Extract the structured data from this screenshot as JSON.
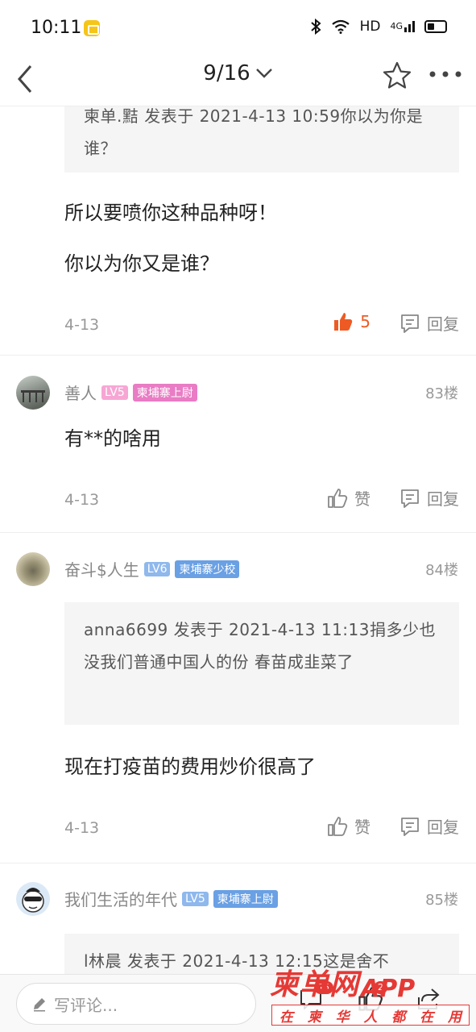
{
  "status_bar": {
    "time": "10:11",
    "network": "HD",
    "signal": "4G"
  },
  "nav": {
    "title": "9/16"
  },
  "thread": [
    {
      "quote": "柬单.黠 发表于 2021-4-13 10:59你以为你是谁？",
      "lines": [
        "所以要喷你这种品种呀！",
        "你以为你又是谁？"
      ],
      "date": "4-13",
      "like_label": "5",
      "liked": true,
      "reply_label": "回复"
    }
  ],
  "posts": [
    {
      "author": "善人",
      "level": "LV5",
      "level_color": "#f7a6d4",
      "badge": "柬埔寨上尉",
      "badge_color": "#e97cc4",
      "floor": "83楼",
      "text": "有**的啥用",
      "date": "4-13",
      "like_label": "赞",
      "reply_label": "回复"
    },
    {
      "author": "奋斗$人生",
      "level": "LV6",
      "level_color": "#8fb8ec",
      "badge": "柬埔寨少校",
      "badge_color": "#6aa0e4",
      "floor": "84楼",
      "quote": "anna6699 发表于 2021-4-13 11:13捐多少也没我们普通中国人的份  春苗成韭菜了",
      "text": "现在打疫苗的费用炒价很高了",
      "date": "4-13",
      "like_label": "赞",
      "reply_label": "回复"
    },
    {
      "author": "我们生活的年代",
      "level": "LV5",
      "level_color": "#8fb8ec",
      "badge": "柬埔寨上尉",
      "badge_color": "#6aa0e4",
      "floor": "85楼",
      "quote": "l林晨 发表于 2021-4-13 12:15这是舍不"
    }
  ],
  "bottom_bar": {
    "placeholder": "写评论...",
    "comment_count": "15",
    "like_count": "2"
  },
  "watermark": {
    "brand": "柬单网",
    "app": "APP",
    "slogan": [
      "在",
      "柬",
      "华",
      "人",
      "都",
      "在",
      "用"
    ]
  },
  "colors": {
    "accent_like": "#ee5a24",
    "brand_red": "#e53935"
  }
}
